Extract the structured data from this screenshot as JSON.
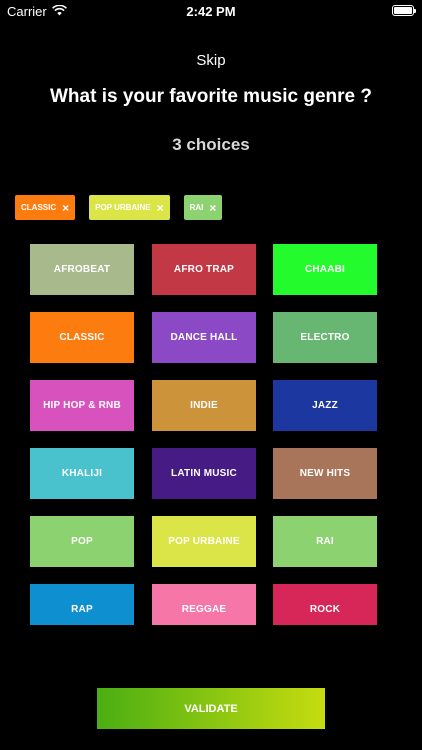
{
  "status": {
    "carrier": "Carrier",
    "time": "2:42 PM",
    "battery_level": 1.0
  },
  "skip_label": "Skip",
  "title": "What is your favorite music genre ?",
  "choices_label": "3 choices",
  "selected_chips": [
    {
      "label": "CLASSIC",
      "color": "#fd7c0f"
    },
    {
      "label": "POP URBAINE",
      "color": "#dbe547"
    },
    {
      "label": "RAI",
      "color": "#8dd271"
    }
  ],
  "chip_remove_glyph": "×",
  "genres": [
    {
      "label": "AFROBEAT",
      "color": "#a8ba8b"
    },
    {
      "label": "AFRO TRAP",
      "color": "#c23845"
    },
    {
      "label": "CHAABI",
      "color": "#23fb2d"
    },
    {
      "label": "CLASSIC",
      "color": "#fd7c0f"
    },
    {
      "label": "DANCE HALL",
      "color": "#8c49c6"
    },
    {
      "label": "ELECTRO",
      "color": "#67b672"
    },
    {
      "label": "HIP HOP & RNB",
      "color": "#d852bd"
    },
    {
      "label": "INDIE",
      "color": "#cc933a"
    },
    {
      "label": "JAZZ",
      "color": "#1c37a0"
    },
    {
      "label": "KHALIJI",
      "color": "#49c2cd"
    },
    {
      "label": "LATIN MUSIC",
      "color": "#461b83"
    },
    {
      "label": "NEW HITS",
      "color": "#a9755a"
    },
    {
      "label": "POP",
      "color": "#8dd271"
    },
    {
      "label": "POP URBAINE",
      "color": "#dbe547"
    },
    {
      "label": "RAI",
      "color": "#8dd271"
    },
    {
      "label": "RAP",
      "color": "#0e8fcf"
    },
    {
      "label": "REGGAE",
      "color": "#f776a8"
    },
    {
      "label": "ROCK",
      "color": "#d72758"
    }
  ],
  "validate_label": "VALIDATE"
}
